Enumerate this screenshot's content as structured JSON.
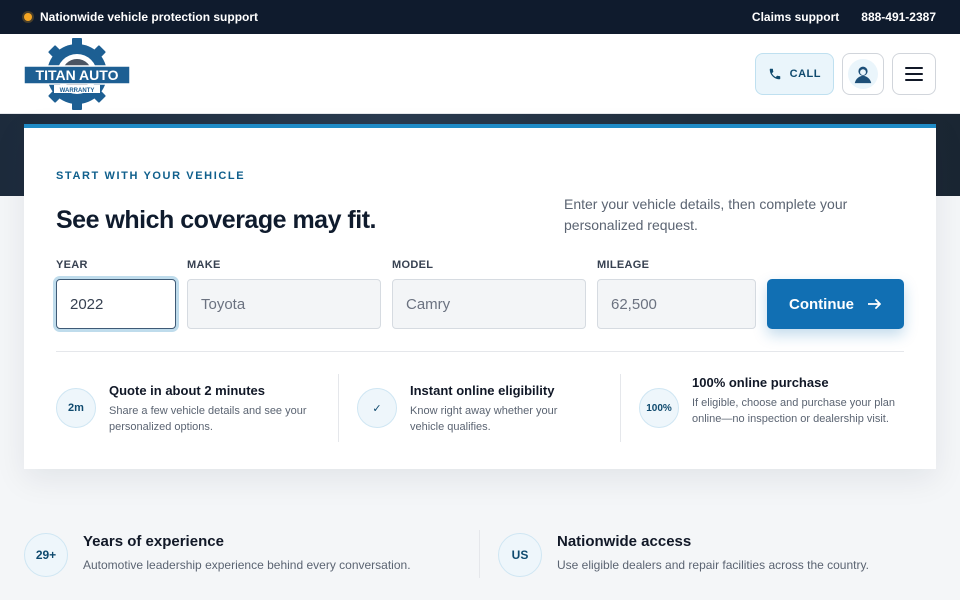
{
  "topbar": {
    "announcement": "Nationwide vehicle protection support",
    "claims_link": "Claims support",
    "phone": "888-491-2387"
  },
  "header": {
    "logo": {
      "brand": "TITAN AUTO",
      "sub": "WARRANTY"
    },
    "call_label": "CALL",
    "icons": {
      "phone": "phone-icon",
      "account": "user-icon",
      "menu": "hamburger-menu-icon"
    }
  },
  "card": {
    "eyebrow": "START WITH YOUR VEHICLE",
    "headline": "See which coverage may fit.",
    "intro": "Enter your vehicle details, then complete your personalized request.",
    "fields": {
      "year": {
        "label": "YEAR",
        "value": "2022"
      },
      "make": {
        "label": "MAKE",
        "value": "Toyota"
      },
      "model": {
        "label": "MODEL",
        "value": "Camry"
      },
      "mileage": {
        "label": "MILEAGE",
        "value": "62,500"
      }
    },
    "continue_label": "Continue",
    "features": [
      {
        "badge": "2m",
        "title": "Quote in about 2 minutes",
        "desc": "Share a few vehicle details and see your personalized options."
      },
      {
        "badge": "✓",
        "title": "Instant online eligibility",
        "desc": "Know right away whether your vehicle qualifies."
      },
      {
        "badge": "100%",
        "title": "100% online purchase",
        "desc": "If eligible, choose and purchase your plan online—no inspection or dealership visit."
      }
    ]
  },
  "stats": [
    {
      "badge": "29+",
      "title": "Years of experience",
      "desc": "Automotive leadership experience behind every conversation."
    },
    {
      "badge": "US",
      "title": "Nationwide access",
      "desc": "Use eligible dealers and repair facilities across the country."
    }
  ],
  "colors": {
    "accent": "#116fb3",
    "topbar_bg": "#0f1b2d",
    "focus_ring": "#bfdcec",
    "announcement_dot": "#f5a623"
  }
}
